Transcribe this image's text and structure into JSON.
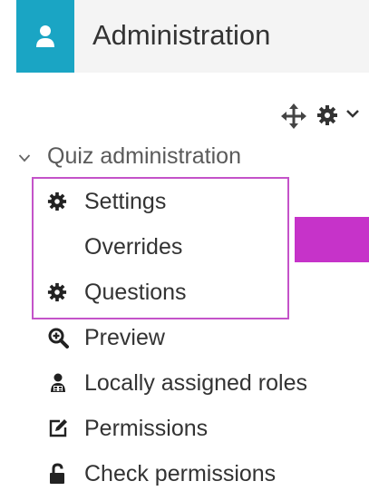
{
  "header": {
    "title": "Administration"
  },
  "tree": {
    "root_label": "Quiz administration",
    "items": [
      {
        "label": "Settings",
        "icon": "gear-icon"
      },
      {
        "label": "Overrides",
        "icon": ""
      },
      {
        "label": "Questions",
        "icon": "gear-icon"
      },
      {
        "label": "Preview",
        "icon": "magnifier-plus-icon"
      },
      {
        "label": "Locally assigned roles",
        "icon": "user-roles-icon"
      },
      {
        "label": "Permissions",
        "icon": "edit-icon"
      },
      {
        "label": "Check permissions",
        "icon": "unlock-icon"
      }
    ]
  },
  "colors": {
    "header_icon_bg": "#1aa5c4",
    "highlight_border": "#c453c9",
    "highlight_bar": "#c633c9"
  }
}
